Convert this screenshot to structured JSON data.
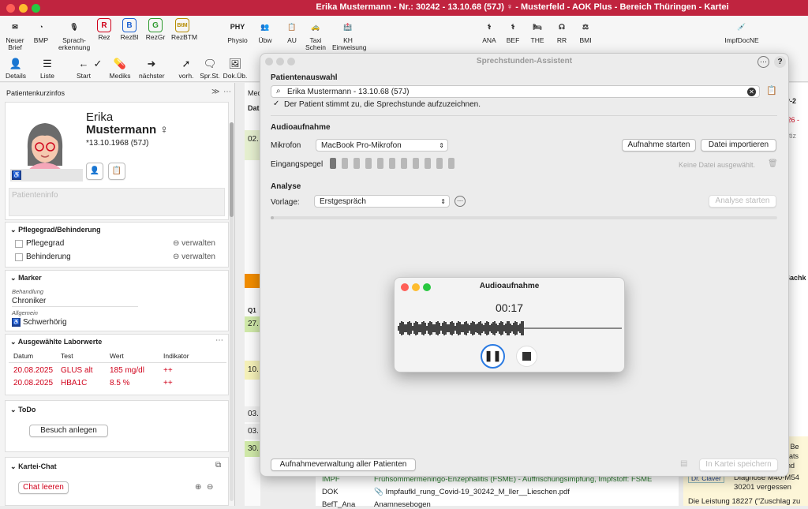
{
  "window": {
    "title": "Erika Mustermann - Nr.: 30242 - 13.10.68 (57J) ♀ - Musterfeld - AOK Plus - Bereich Thüringen - Kartei"
  },
  "toolbar1": [
    {
      "label": "Neuer\nBrief",
      "icon": "envelope"
    },
    {
      "label": "BMP",
      "icon": "pill"
    },
    {
      "label": "Sprach-\nerkennung",
      "icon": "mic"
    },
    {
      "label": "Rez",
      "icon": "R"
    },
    {
      "label": "RezBl",
      "icon": "B"
    },
    {
      "label": "RezGr",
      "icon": "G"
    },
    {
      "label": "RezBTM",
      "icon": "BtM"
    },
    {
      "label": "Physio",
      "icon": "PHY"
    },
    {
      "label": "Übw",
      "icon": "users"
    },
    {
      "label": "AU",
      "icon": "clipboard"
    },
    {
      "label": "Taxi\nSchein",
      "icon": "taxi"
    },
    {
      "label": "KH\nEinweisung",
      "icon": "hospital"
    },
    {
      "label": "ANA",
      "icon": "doctor"
    },
    {
      "label": "BEF",
      "icon": "doctor"
    },
    {
      "label": "THE",
      "icon": "therapy"
    },
    {
      "label": "RR",
      "icon": "stethoscope"
    },
    {
      "label": "BMI",
      "icon": "scale"
    },
    {
      "label": "ImpfDocNE",
      "icon": "syringe"
    }
  ],
  "toolbar2": [
    {
      "label": "Details",
      "icon": "person"
    },
    {
      "label": "Liste",
      "icon": "list"
    },
    {
      "label": "Start",
      "icon": "back"
    },
    {
      "label": "",
      "icon": "check"
    },
    {
      "label": "Mediks",
      "icon": "pills"
    },
    {
      "label": "nächster",
      "icon": "next"
    },
    {
      "label": "vorh.",
      "icon": "prev"
    },
    {
      "label": "Spr.St.",
      "icon": "speech"
    },
    {
      "label": "Dok.Üb.",
      "icon": "photo"
    }
  ],
  "left": {
    "panel_title": "Patientenkurzinfos",
    "first_name": "Erika",
    "last_name": "Mustermann ♀",
    "dob": "*13.10.1968 (57J)",
    "patient_info_placeholder": "Patienteninfo",
    "care": {
      "title": "Pflegegrad/Behinderung",
      "rows": [
        {
          "label": "Pflegegrad",
          "action": "verwalten"
        },
        {
          "label": "Behinderung",
          "action": "verwalten"
        }
      ]
    },
    "marker": {
      "title": "Marker",
      "groups": [
        {
          "caption": "Behandlung",
          "value": "Chroniker"
        },
        {
          "caption": "Allgemein",
          "value": "Schwerhörig"
        }
      ]
    },
    "lab": {
      "title": "Ausgewählte Laborwerte",
      "headers": [
        "Datum",
        "Test",
        "Wert",
        "Indikator"
      ],
      "rows": [
        [
          "20.08.2025",
          "GLUS alt",
          "185 mg/dl",
          "++"
        ],
        [
          "20.08.2025",
          "HBA1C",
          "8.5 %",
          "++"
        ]
      ]
    },
    "todo": {
      "title": "ToDo",
      "button": "Besuch anlegen"
    },
    "chat": {
      "title": "Kartei-Chat",
      "button": "Chat leeren"
    }
  },
  "mid": {
    "header": "Med",
    "col": "Dat",
    "rows": [
      "02.",
      "Q1",
      "27.",
      "10.",
      "03.",
      "03.",
      "30."
    ]
  },
  "right": {
    "items": [
      "P-2",
      ".26 -",
      "otiz",
      "Sachk",
      "ale Be",
      "parats",
      "hand",
      "Dr. Claver",
      "Diagnose M40-M54",
      "30201 vergessen",
      "Die Leistung 18227 (\"Zuschlag zu"
    ]
  },
  "bottom": {
    "rows": [
      {
        "code": "IMPF",
        "text": "Frühsommermeningo-Enzephalitis (FSME) - Auffrischungsimpfung, Impfstoff: FSME"
      },
      {
        "code": "DOK",
        "text": "Impfaufkl_rung_Covid-19_30242_M_ller__Lieschen.pdf"
      },
      {
        "code": "BefT_Ana",
        "text": "Anamnesebogen"
      }
    ]
  },
  "dialog": {
    "title": "Sprechstunden-Assistent",
    "patient_section": "Patientenauswahl",
    "patient_value": "Erika Mustermann - 13.10.68 (57J)",
    "consent": "Der Patient stimmt zu, die Sprechstunde aufzuzeichnen.",
    "audio_section": "Audioaufnahme",
    "mic_label": "Mikrofon",
    "mic_value": "MacBook Pro-Mikrofon",
    "start_button": "Aufnahme starten",
    "import_button": "Datei importieren",
    "input_label": "Eingangspegel",
    "no_file": "Keine Datei ausgewählt.",
    "analysis_section": "Analyse",
    "template_label": "Vorlage:",
    "template_value": "Erstgespräch",
    "analyze_button": "Analyse starten",
    "manage_button": "Aufnahmeverwaltung aller Patienten",
    "save_button": "In Kartei speichern"
  },
  "audio": {
    "title": "Audioaufnahme",
    "time": "00:17"
  },
  "colors": {
    "titlebar": "#c0243f",
    "lab_red": "#d0021b",
    "accent": "#2a7ae2"
  }
}
